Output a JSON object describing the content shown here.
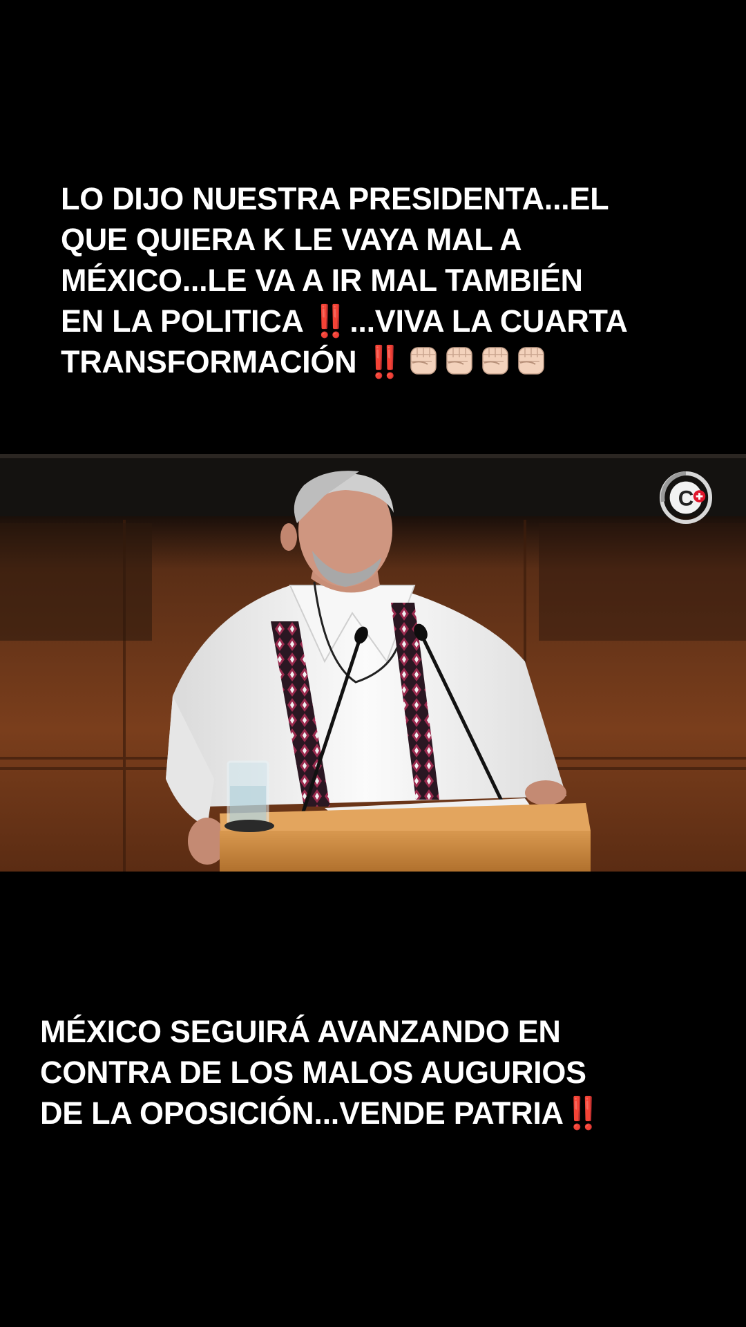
{
  "top_caption": {
    "text": "LO DIJO NUESTRA PRESIDENTA...EL\nQUE QUIERA K LE VAYA MAL A\nMÉXICO...LE VA A IR MAL TAMBIÉN\nEN LA POLITICA ",
    "mid": "...VIVA LA CUARTA\nTRANSFORMACIÓN ",
    "emoji_bang": "‼️",
    "fist_count": 4,
    "fist_color": "#f3d2bc"
  },
  "bottom_caption": {
    "text": "MÉXICO  SEGUIRÁ AVANZANDO EN\nCONTRA DE LOS MALOS AUGURIOS\nDE LA OPOSICIÓN...VENDE PATRIA",
    "emoji_bang": "‼️"
  },
  "video": {
    "channel_logo_icon": "c-plus-channel-logo",
    "accent_color": "#e0162b"
  }
}
